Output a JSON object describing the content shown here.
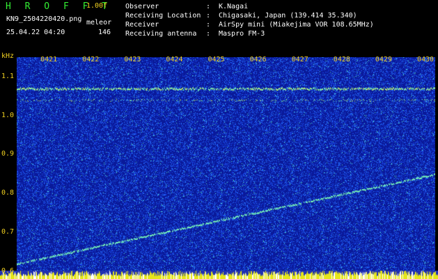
{
  "header": {
    "app_title": "H R O F F T",
    "version": "1.00f",
    "filename": "KN9_2504220420.png",
    "method": "meleor",
    "datetime": "25.04.22 04:20",
    "count": "146"
  },
  "station_info": [
    {
      "key": "Observer",
      "value": "K.Nagai"
    },
    {
      "key": "Receiving Location",
      "value": "Chigasaki, Japan (139.414 35.340)"
    },
    {
      "key": "Receiver",
      "value": "AirSpy mini (Miakejima VOR 108.65MHz)"
    },
    {
      "key": "Receiving antenna",
      "value": "Maspro FM-3"
    }
  ],
  "separator": ":",
  "chart_data": {
    "type": "heatmap",
    "ylabel": "kHz",
    "y_ticks": [
      "1.1",
      "1.0",
      "0.9",
      "0.8",
      "0.7",
      "0.6"
    ],
    "x_ticks": [
      "0421",
      "0422",
      "0423",
      "0424",
      "0425",
      "0426",
      "0427",
      "0428",
      "0429",
      "0430"
    ],
    "ylim": [
      0.58,
      1.15
    ],
    "xlim": [
      "04:20",
      "04:30"
    ],
    "features": [
      {
        "label": "carrier band",
        "freq": 1.07
      },
      {
        "label": "faint band",
        "freq": 1.04
      },
      {
        "label": "drifting trace",
        "start": {
          "time": "04:20",
          "freq": 0.62
        },
        "end": {
          "time": "04:30",
          "freq": 0.85
        }
      }
    ],
    "colors": {
      "background": "#0a1a9a",
      "noise": "#3b7bff",
      "signal": "#7dffb8",
      "axis_text": "#f0d020",
      "base_strip": "#e6e61a"
    }
  }
}
